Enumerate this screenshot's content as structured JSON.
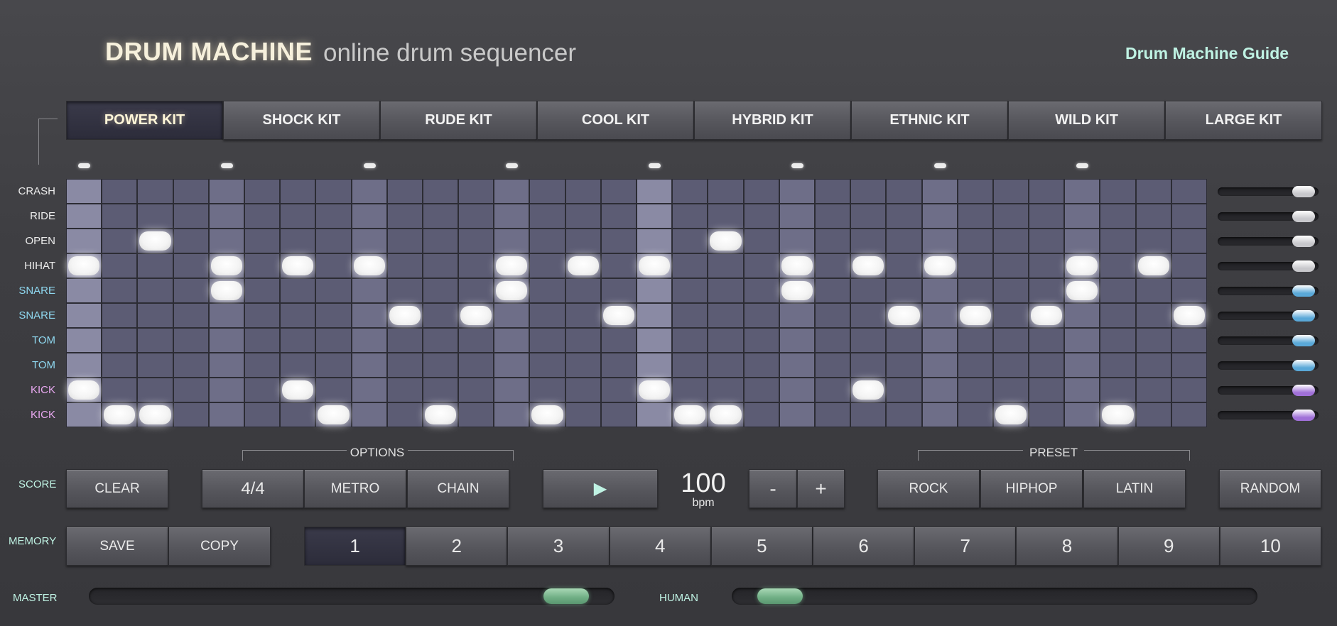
{
  "header": {
    "title": "DRUM MACHINE",
    "subtitle": "online drum sequencer",
    "guide_link": "Drum Machine Guide"
  },
  "kits": [
    "POWER KIT",
    "SHOCK KIT",
    "RUDE KIT",
    "COOL KIT",
    "HYBRID KIT",
    "ETHNIC KIT",
    "WILD KIT",
    "LARGE KIT"
  ],
  "active_kit": 0,
  "steps": 32,
  "tracks": [
    {
      "label": "CRASH",
      "color": "#ececec",
      "volume": 0.95,
      "knob_color": "#c8c8cc",
      "pattern": []
    },
    {
      "label": "RIDE",
      "color": "#ececec",
      "volume": 0.95,
      "knob_color": "#c8c8cc",
      "pattern": []
    },
    {
      "label": "OPEN",
      "color": "#ececec",
      "volume": 0.95,
      "knob_color": "#c8c8cc",
      "pattern": [
        2,
        18
      ]
    },
    {
      "label": "HIHAT",
      "color": "#ececec",
      "volume": 0.95,
      "knob_color": "#c8c8cc",
      "pattern": [
        0,
        4,
        6,
        8,
        12,
        14,
        16,
        20,
        22,
        24,
        28,
        30
      ]
    },
    {
      "label": "SNARE",
      "color": "#8fd8f0",
      "volume": 0.95,
      "knob_color": "#5aa8d8",
      "pattern": [
        4,
        12,
        20,
        28
      ]
    },
    {
      "label": "SNARE",
      "color": "#8fd8f0",
      "volume": 0.95,
      "knob_color": "#5aa8d8",
      "pattern": [
        9,
        11,
        15,
        23,
        25,
        27,
        31
      ]
    },
    {
      "label": "TOM",
      "color": "#8fd8f0",
      "volume": 0.95,
      "knob_color": "#5aa8d8",
      "pattern": []
    },
    {
      "label": "TOM",
      "color": "#8fd8f0",
      "volume": 0.95,
      "knob_color": "#5aa8d8",
      "pattern": []
    },
    {
      "label": "KICK",
      "color": "#e8a8f0",
      "volume": 0.95,
      "knob_color": "#a070d8",
      "pattern": [
        0,
        6,
        16,
        22
      ]
    },
    {
      "label": "KICK",
      "color": "#e8a8f0",
      "volume": 0.95,
      "knob_color": "#a070d8",
      "pattern": [
        1,
        2,
        7,
        10,
        13,
        17,
        18,
        26,
        29
      ]
    }
  ],
  "options": {
    "label": "OPTIONS",
    "time_signature": "4/4",
    "metro": "METRO",
    "chain": "CHAIN"
  },
  "preset": {
    "label": "PRESET",
    "items": [
      "ROCK",
      "HIPHOP",
      "LATIN"
    ],
    "random": "RANDOM"
  },
  "score": {
    "label": "SCORE",
    "clear": "CLEAR"
  },
  "transport": {
    "play_icon": "play-icon",
    "play_glyph": "▶",
    "bpm": "100",
    "bpm_unit": "bpm",
    "minus": "-",
    "plus": "+"
  },
  "memory": {
    "label": "MEMORY",
    "save": "SAVE",
    "copy": "COPY",
    "slots": [
      "1",
      "2",
      "3",
      "4",
      "5",
      "6",
      "7",
      "8",
      "9",
      "10"
    ],
    "active_slot": 0
  },
  "master": {
    "label": "MASTER",
    "value": 0.95
  },
  "human": {
    "label": "HUMAN",
    "value": 0.05
  },
  "colors": {
    "accent": "#bff2e3",
    "cell": "#5c5c74",
    "cell_beat": "#8a8aa4",
    "cell_quarter": "#6e6e88"
  }
}
